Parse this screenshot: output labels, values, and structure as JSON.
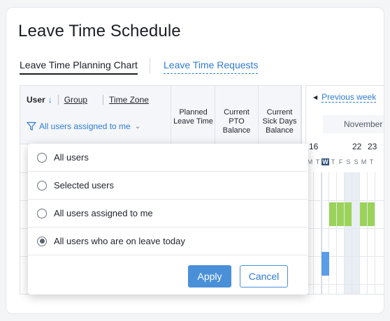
{
  "page": {
    "title": "Leave Time Schedule"
  },
  "tabs": [
    {
      "label": "Leave Time Planning Chart",
      "active": true
    },
    {
      "label": "Leave Time Requests",
      "active": false
    }
  ],
  "table": {
    "sort": {
      "user": "User",
      "user_arrow": "↓",
      "group": "Group",
      "time_zone": "Time Zone"
    },
    "filter_label": "All users assigned to me",
    "columns": [
      {
        "label": "Planned Leave Time"
      },
      {
        "label": "Current PTO Balance"
      },
      {
        "label": "Current Sick Days Balance"
      }
    ]
  },
  "calendar": {
    "prev_label": "Previous week",
    "month": "November",
    "day_numbers": [
      "16",
      "22",
      "23"
    ],
    "weekday_letters": [
      "M",
      "T",
      "W",
      "T",
      "F",
      "S",
      "S",
      "M",
      "T"
    ],
    "today_letter": "W",
    "colors": {
      "green": "#9bd35a",
      "blue": "#5b9de8",
      "weekend": "#e9eef5",
      "today": "#2f4f79"
    }
  },
  "dropdown": {
    "options": [
      {
        "label": "All users",
        "selected": false
      },
      {
        "label": "Selected users",
        "selected": false
      },
      {
        "label": "All users assigned to me",
        "selected": false
      },
      {
        "label": "All users who are on leave today",
        "selected": true
      }
    ],
    "apply_label": "Apply",
    "cancel_label": "Cancel"
  },
  "colors": {
    "accent": "#4a90d9",
    "link": "#2f7bd3"
  }
}
